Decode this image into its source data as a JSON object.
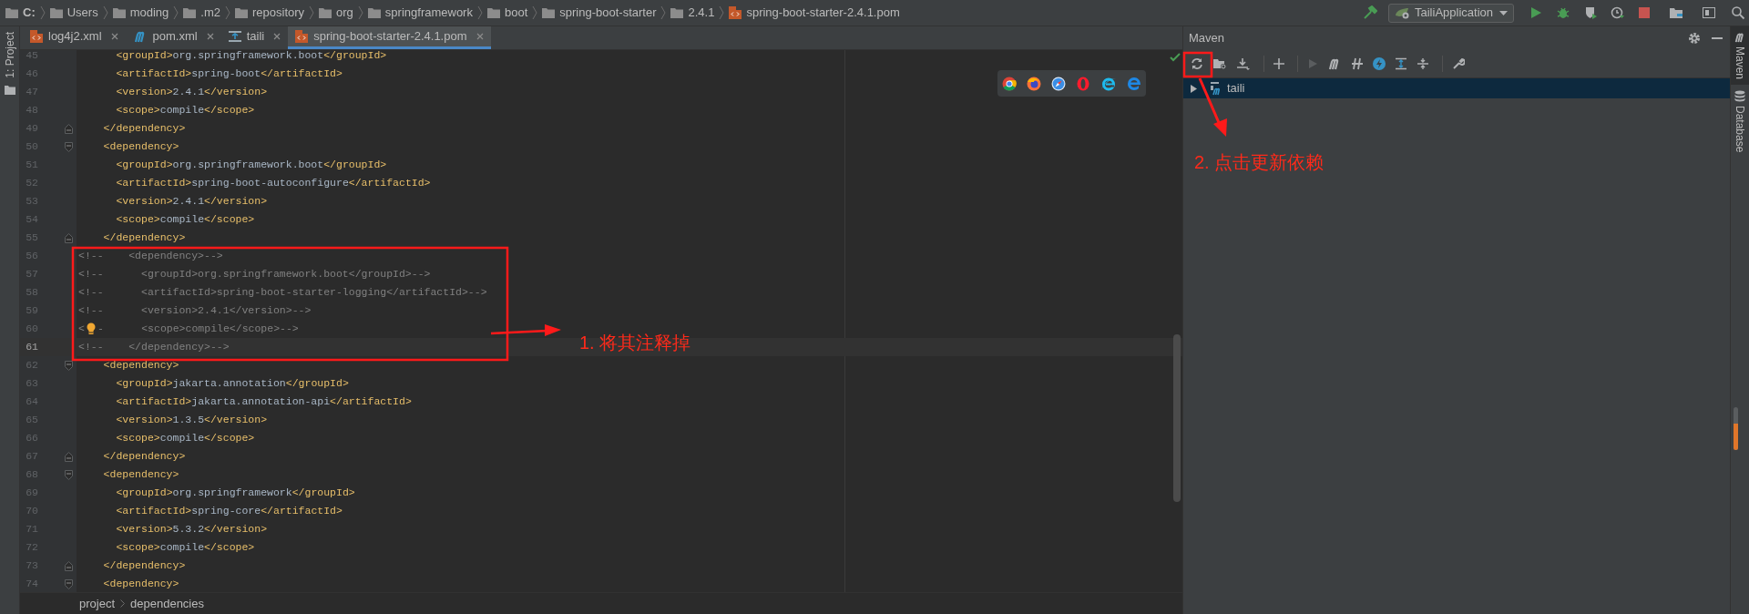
{
  "breadcrumbs": [
    {
      "label": "C:",
      "kind": "drive"
    },
    {
      "label": "Users",
      "kind": "folder"
    },
    {
      "label": "moding",
      "kind": "folder"
    },
    {
      "label": ".m2",
      "kind": "folder"
    },
    {
      "label": "repository",
      "kind": "folder"
    },
    {
      "label": "org",
      "kind": "folder"
    },
    {
      "label": "springframework",
      "kind": "folder"
    },
    {
      "label": "boot",
      "kind": "folder"
    },
    {
      "label": "spring-boot-starter",
      "kind": "folder"
    },
    {
      "label": "2.4.1",
      "kind": "folder"
    },
    {
      "label": "spring-boot-starter-2.4.1.pom",
      "kind": "file"
    }
  ],
  "run_configuration": "TailiApplication",
  "left_tool_strip": {
    "label": "1: Project"
  },
  "tabs": [
    {
      "label": "log4j2.xml",
      "kind": "xml",
      "selected": false
    },
    {
      "label": "pom.xml",
      "kind": "maven",
      "selected": false
    },
    {
      "label": "taili",
      "kind": "module",
      "selected": false
    },
    {
      "label": "spring-boot-starter-2.4.1.pom",
      "kind": "xml",
      "selected": true
    }
  ],
  "editor": {
    "lines": [
      {
        "number": "45",
        "text": "      <groupId>org.springframework.boot</groupId>",
        "kind": "code",
        "current": false,
        "bulb": false,
        "fold_start": false,
        "fold_end": false
      },
      {
        "number": "46",
        "text": "      <artifactId>spring-boot</artifactId>",
        "kind": "code",
        "current": false,
        "bulb": false,
        "fold_start": false,
        "fold_end": false
      },
      {
        "number": "47",
        "text": "      <version>2.4.1</version>",
        "kind": "code",
        "current": false,
        "bulb": false,
        "fold_start": false,
        "fold_end": false
      },
      {
        "number": "48",
        "text": "      <scope>compile</scope>",
        "kind": "code",
        "current": false,
        "bulb": false,
        "fold_start": false,
        "fold_end": false
      },
      {
        "number": "49",
        "text": "    </dependency>",
        "kind": "code",
        "current": false,
        "bulb": false,
        "fold_start": false,
        "fold_end": true
      },
      {
        "number": "50",
        "text": "    <dependency>",
        "kind": "code",
        "current": false,
        "bulb": false,
        "fold_start": true,
        "fold_end": false
      },
      {
        "number": "51",
        "text": "      <groupId>org.springframework.boot</groupId>",
        "kind": "code",
        "current": false,
        "bulb": false,
        "fold_start": false,
        "fold_end": false
      },
      {
        "number": "52",
        "text": "      <artifactId>spring-boot-autoconfigure</artifactId>",
        "kind": "code",
        "current": false,
        "bulb": false,
        "fold_start": false,
        "fold_end": false
      },
      {
        "number": "53",
        "text": "      <version>2.4.1</version>",
        "kind": "code",
        "current": false,
        "bulb": false,
        "fold_start": false,
        "fold_end": false
      },
      {
        "number": "54",
        "text": "      <scope>compile</scope>",
        "kind": "code",
        "current": false,
        "bulb": false,
        "fold_start": false,
        "fold_end": false
      },
      {
        "number": "55",
        "text": "    </dependency>",
        "kind": "code",
        "current": false,
        "bulb": false,
        "fold_start": false,
        "fold_end": true
      },
      {
        "number": "56",
        "text": "<!--    <dependency>-->",
        "kind": "comment",
        "current": false,
        "bulb": false,
        "fold_start": false,
        "fold_end": false
      },
      {
        "number": "57",
        "text": "<!--      <groupId>org.springframework.boot</groupId>-->",
        "kind": "comment",
        "current": false,
        "bulb": false,
        "fold_start": false,
        "fold_end": false
      },
      {
        "number": "58",
        "text": "<!--      <artifactId>spring-boot-starter-logging</artifactId>-->",
        "kind": "comment",
        "current": false,
        "bulb": false,
        "fold_start": false,
        "fold_end": false
      },
      {
        "number": "59",
        "text": "<!--      <version>2.4.1</version>-->",
        "kind": "comment",
        "current": false,
        "bulb": false,
        "fold_start": false,
        "fold_end": false
      },
      {
        "number": "60",
        "lead": "<",
        "text": "-      <scope>compile</scope>-->",
        "kind": "comment",
        "current": false,
        "bulb": true,
        "fold_start": false,
        "fold_end": false
      },
      {
        "number": "61",
        "text": "<!--    </dependency>-->",
        "kind": "comment",
        "current": true,
        "bulb": false,
        "fold_start": false,
        "fold_end": false
      },
      {
        "number": "62",
        "text": "    <dependency>",
        "kind": "code",
        "current": false,
        "bulb": false,
        "fold_start": true,
        "fold_end": false
      },
      {
        "number": "63",
        "text": "      <groupId>jakarta.annotation</groupId>",
        "kind": "code",
        "current": false,
        "bulb": false,
        "fold_start": false,
        "fold_end": false
      },
      {
        "number": "64",
        "text": "      <artifactId>jakarta.annotation-api</artifactId>",
        "kind": "code",
        "current": false,
        "bulb": false,
        "fold_start": false,
        "fold_end": false
      },
      {
        "number": "65",
        "text": "      <version>1.3.5</version>",
        "kind": "code",
        "current": false,
        "bulb": false,
        "fold_start": false,
        "fold_end": false
      },
      {
        "number": "66",
        "text": "      <scope>compile</scope>",
        "kind": "code",
        "current": false,
        "bulb": false,
        "fold_start": false,
        "fold_end": false
      },
      {
        "number": "67",
        "text": "    </dependency>",
        "kind": "code",
        "current": false,
        "bulb": false,
        "fold_start": false,
        "fold_end": true
      },
      {
        "number": "68",
        "text": "    <dependency>",
        "kind": "code",
        "current": false,
        "bulb": false,
        "fold_start": true,
        "fold_end": false
      },
      {
        "number": "69",
        "text": "      <groupId>org.springframework</groupId>",
        "kind": "code",
        "current": false,
        "bulb": false,
        "fold_start": false,
        "fold_end": false
      },
      {
        "number": "70",
        "text": "      <artifactId>spring-core</artifactId>",
        "kind": "code",
        "current": false,
        "bulb": false,
        "fold_start": false,
        "fold_end": false
      },
      {
        "number": "71",
        "text": "      <version>5.3.2</version>",
        "kind": "code",
        "current": false,
        "bulb": false,
        "fold_start": false,
        "fold_end": false
      },
      {
        "number": "72",
        "text": "      <scope>compile</scope>",
        "kind": "code",
        "current": false,
        "bulb": false,
        "fold_start": false,
        "fold_end": false
      },
      {
        "number": "73",
        "text": "    </dependency>",
        "kind": "code",
        "current": false,
        "bulb": false,
        "fold_start": false,
        "fold_end": true
      },
      {
        "number": "74",
        "text": "    <dependency>",
        "kind": "code",
        "current": false,
        "bulb": false,
        "fold_start": true,
        "fold_end": false
      }
    ]
  },
  "status_path": [
    "project",
    "dependencies"
  ],
  "maven": {
    "title": "Maven",
    "tree": [
      {
        "label": "taili",
        "selected": true,
        "expanded": false
      }
    ]
  },
  "right_tool_strip": [
    {
      "label": "Maven",
      "kind": "maven",
      "selected": true
    },
    {
      "label": "Database",
      "kind": "database",
      "selected": false
    }
  ],
  "annotations": [
    {
      "text": "1. 将其注释掉"
    },
    {
      "text": "2. 点击更新依赖"
    }
  ]
}
